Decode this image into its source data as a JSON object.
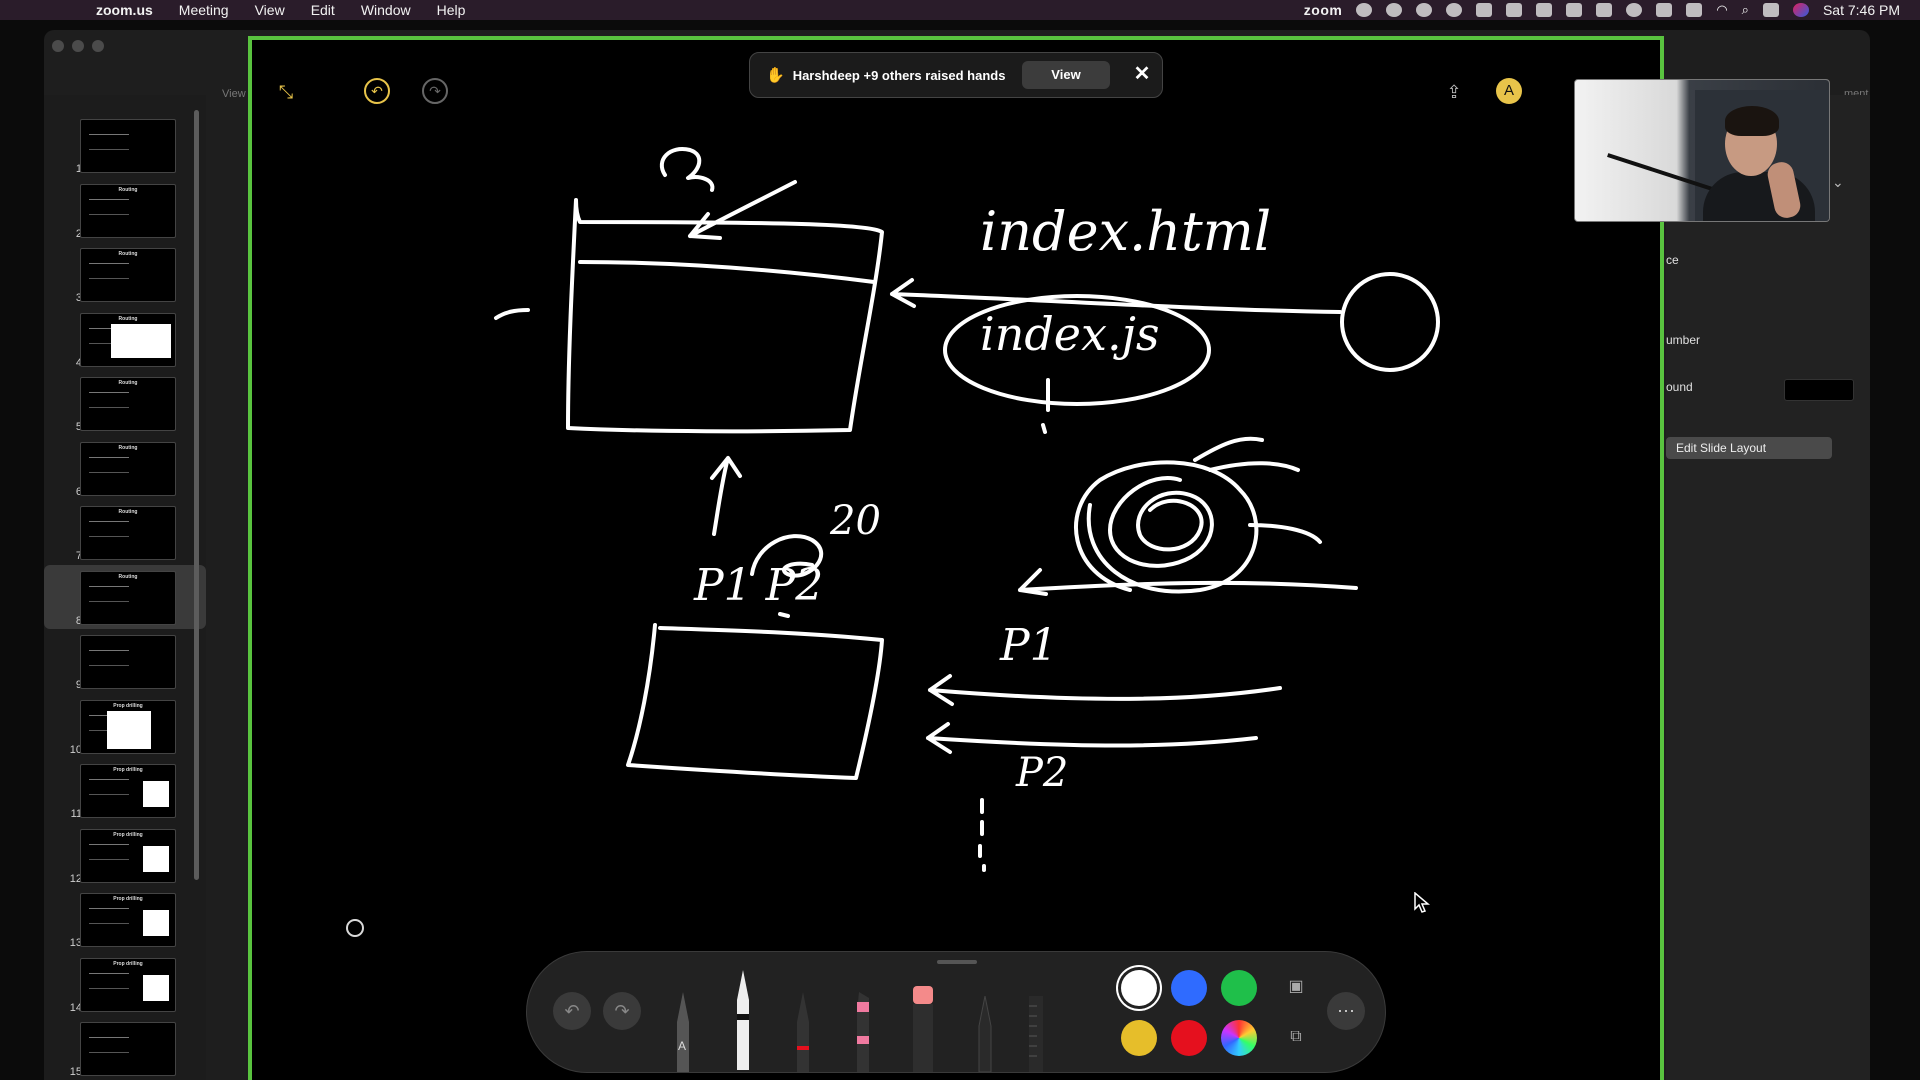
{
  "menubar": {
    "apple": "",
    "items": [
      "zoom.us",
      "Meeting",
      "View",
      "Edit",
      "Window",
      "Help"
    ],
    "status_app": "zoom",
    "clock": "Sat 7:46 PM"
  },
  "notice": {
    "icon": "raised-hand-icon",
    "text": "Harshdeep +9 others raised hands",
    "view_label": "View",
    "close_label": "✕"
  },
  "slides": {
    "numbers": [
      "1",
      "2",
      "3",
      "4",
      "5",
      "6",
      "7",
      "8",
      "9",
      "10",
      "11",
      "12",
      "13",
      "14",
      "15"
    ],
    "titles": [
      "",
      "Routing",
      "Routing",
      "Routing",
      "Routing",
      "Routing",
      "Routing",
      "Routing",
      "",
      "Prop drilling",
      "Prop drilling",
      "Prop drilling",
      "Prop drilling",
      "Prop drilling",
      ""
    ],
    "selected": 8
  },
  "inspector": {
    "label_1": "ce",
    "label_2": "umber",
    "label_3": "ound",
    "edit_layout": "Edit Slide Layout",
    "top_labels": [
      "View",
      "ment"
    ]
  },
  "whiteboard": {
    "texts": {
      "index_html": "index.html",
      "index_js": "index.js",
      "p1_p2": "P1 P2",
      "twenty": "20",
      "p1_right": "P1",
      "p2_right": "P2"
    }
  },
  "pen_bar": {
    "colors": [
      "#ffffff",
      "#2f6bff",
      "#1fbf4a",
      "#e6be2a",
      "#e5101e",
      "multicolor"
    ],
    "selected_color": "#ffffff",
    "tools": [
      "pen-a",
      "pencil",
      "fine-marker",
      "highlighter",
      "eraser",
      "crayon",
      "ruler"
    ]
  }
}
